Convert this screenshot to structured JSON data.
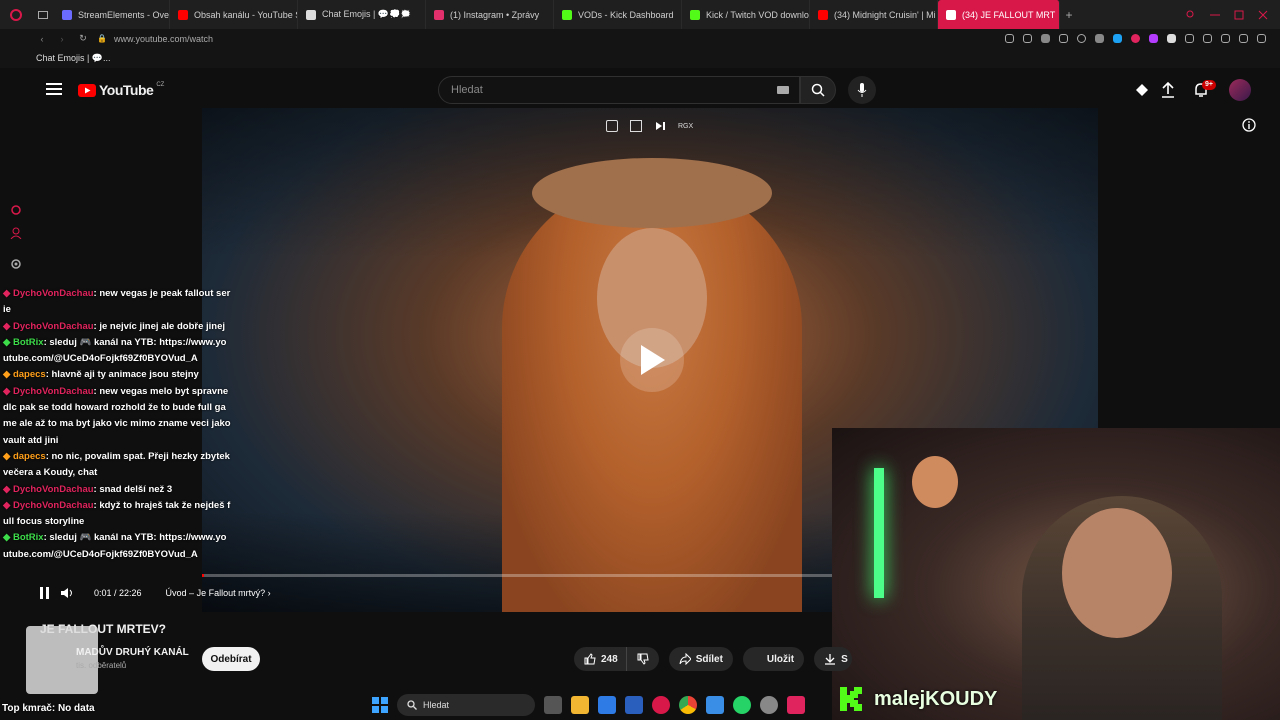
{
  "browser": {
    "tabs": [
      {
        "label": "StreamElements - Overlay",
        "color": "#6b6bff"
      },
      {
        "label": "Obsah kanálu - YouTube S",
        "color": "#ff0000"
      },
      {
        "label": "Chat Emojis | 💬💭🗯️",
        "color": "#dddddd"
      },
      {
        "label": "(1) Instagram • Zprávy",
        "color": "#e1306c"
      },
      {
        "label": "VODs - Kick Dashboard",
        "color": "#53fc18"
      },
      {
        "label": "Kick / Twitch VOD downlo",
        "color": "#53fc18"
      },
      {
        "label": "(34) Midnight Cruisin' | Mi",
        "color": "#ff0000"
      },
      {
        "label": "(34) JE FALLOUT MRT",
        "color": "#ffffff"
      }
    ],
    "url": "www.youtube.com/watch",
    "bookmark": "Chat Emojis | 💬..."
  },
  "youtube": {
    "logo_text": "YouTube",
    "region": "CZ",
    "search_placeholder": "Hledat",
    "notification_badge": "9+"
  },
  "video": {
    "mini_label": "RGX",
    "time": "0:01 / 22:26",
    "chapter": "Úvod – Je Fallout mrtvý?",
    "progress": 0.001
  },
  "chat": [
    {
      "user": "DychoVonDachau",
      "color": "#e1245e",
      "text": ": new vegas je peak fallout serie"
    },
    {
      "user": "DychoVonDachau",
      "color": "#e1245e",
      "text": ": je nejvíc jinej ale dobře jinej"
    },
    {
      "user": "BotRix",
      "color": "#3ddc4a",
      "text": ": sleduj 🎮 kanál na YTB: https://www.youtube.com/@UCeD4oFojkf69Zf0BYOVud_A"
    },
    {
      "user": "dapecs",
      "color": "#ff9f1a",
      "text": ": hlavně aji ty animace jsou stejny"
    },
    {
      "user": "DychoVonDachau",
      "color": "#e1245e",
      "text": ": new vegas melo byt spravne dlc pak se todd howard rozhold že to bude full game ale až to ma byt jako vic mimo zname veci jako vault atd jini"
    },
    {
      "user": "dapecs",
      "color": "#ff9f1a",
      "text": ": no nic, povalim spat. Přeji hezky zbytek večera a Koudy, chat"
    },
    {
      "user": "DychoVonDachau",
      "color": "#e1245e",
      "text": ": snad delší než 3"
    },
    {
      "user": "DychoVonDachau",
      "color": "#e1245e",
      "text": ": když to hraješ tak že nejdeš full focus storyline"
    },
    {
      "user": "BotRix",
      "color": "#3ddc4a",
      "text": ": sleduj 🎮 kanál na YTB: https://www.youtube.com/@UCeD4oFojkf69Zf0BYOVud_A"
    }
  ],
  "meta": {
    "title": "JE FALLOUT MRTEV?",
    "channel": "MADŮV DRUHÝ KANÁL",
    "subscribers": "tis. odběratelů",
    "subscribe": "Odebírat",
    "likes": "248",
    "share": "Sdílet",
    "save": "Uložit",
    "download_partial": "S"
  },
  "webcam": {
    "name": "malejKOUDY"
  },
  "taskbar": {
    "search": "Hledat"
  },
  "status": {
    "bottom": "Top kmrač: No data"
  }
}
